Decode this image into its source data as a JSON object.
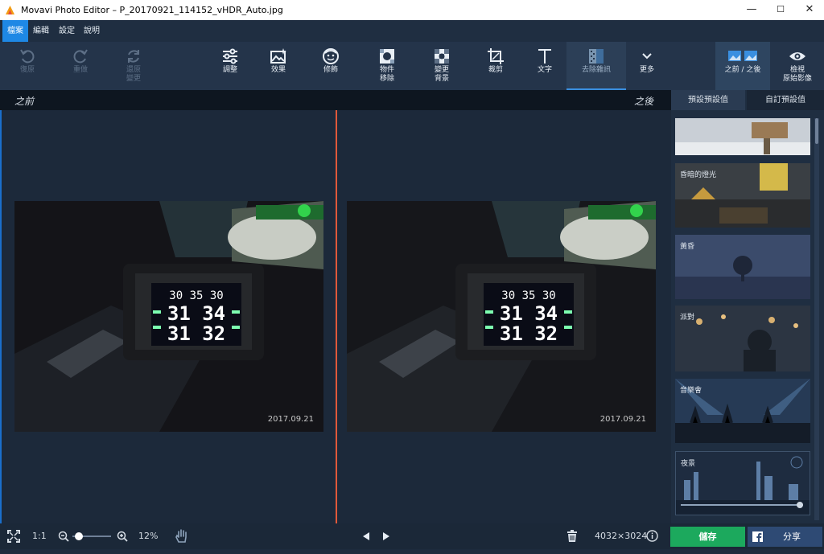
{
  "window": {
    "title": "Movavi Photo Editor – P_20170921_114152_vHDR_Auto.jpg",
    "minimize": "—",
    "maximize": "☐",
    "close": "✕"
  },
  "menu": [
    {
      "label": "檔案"
    },
    {
      "label": "編輯"
    },
    {
      "label": "設定"
    },
    {
      "label": "說明"
    }
  ],
  "toolbar": {
    "undo": "復原",
    "redo": "重做",
    "revert": [
      "還原",
      "變更"
    ],
    "adjust": "調整",
    "effects": "效果",
    "retouch": "修飾",
    "object_removal": [
      "物件",
      "移除"
    ],
    "change_bg": [
      "變更",
      "背景"
    ],
    "crop": "裁剪",
    "text": "文字",
    "denoise": "去除雜訊",
    "more": "更多",
    "before_after": "之前 / 之後",
    "view_original": [
      "檢視",
      "原始影像"
    ]
  },
  "compare": {
    "before": "之前",
    "after": "之後",
    "photo_date": "2017.09.21"
  },
  "panel": {
    "tab_presets": "預設預設值",
    "tab_custom": "自訂預設值",
    "presets": [
      {
        "label": ""
      },
      {
        "label": "昏暗的燈光"
      },
      {
        "label": "黃昏"
      },
      {
        "label": "派對"
      },
      {
        "label": "音樂會"
      },
      {
        "label": "夜景"
      }
    ]
  },
  "status": {
    "zoom_1to1": "1:1",
    "zoom_percent": "12%",
    "zoom_level": 0.12,
    "dimensions": "4032×3024",
    "save": "儲存",
    "share": "分享"
  },
  "colors": {
    "accent": "#1e88e5",
    "save": "#1ca95d",
    "divider": "#e0593a"
  }
}
